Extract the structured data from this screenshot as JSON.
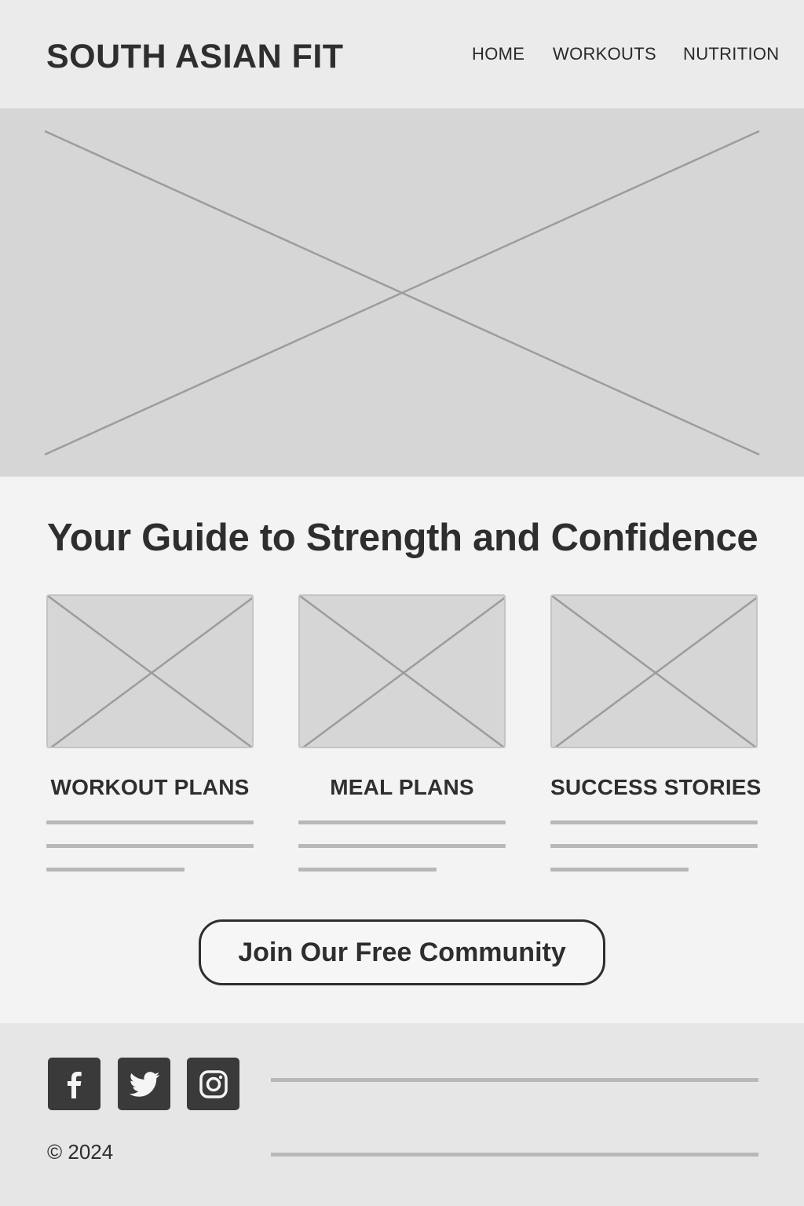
{
  "header": {
    "brand": "SOUTH ASIAN FIT",
    "nav": {
      "home": "HOME",
      "workouts": "WORKOUTS",
      "nutrition": "NUTRITION"
    }
  },
  "hero": {
    "image_icon": "image-placeholder-icon"
  },
  "main": {
    "headline": "Your Guide to Strength and Confidence",
    "cards": [
      {
        "title": "WORKOUT PLANS",
        "image_icon": "image-placeholder-icon"
      },
      {
        "title": "MEAL PLANS",
        "image_icon": "image-placeholder-icon"
      },
      {
        "title": "SUCCESS STORIES",
        "image_icon": "image-placeholder-icon"
      }
    ],
    "cta_label": "Join Our Free Community"
  },
  "footer": {
    "social": [
      {
        "icon": "facebook-icon"
      },
      {
        "icon": "twitter-icon"
      },
      {
        "icon": "instagram-icon"
      }
    ],
    "copyright": "© 2024"
  },
  "colors": {
    "header_bg": "#ebebeb",
    "placeholder_bg": "#d6d6d6",
    "text": "#2e2e2e",
    "footer_bg": "#e6e6e6",
    "social_bg": "#3a3a3a"
  }
}
